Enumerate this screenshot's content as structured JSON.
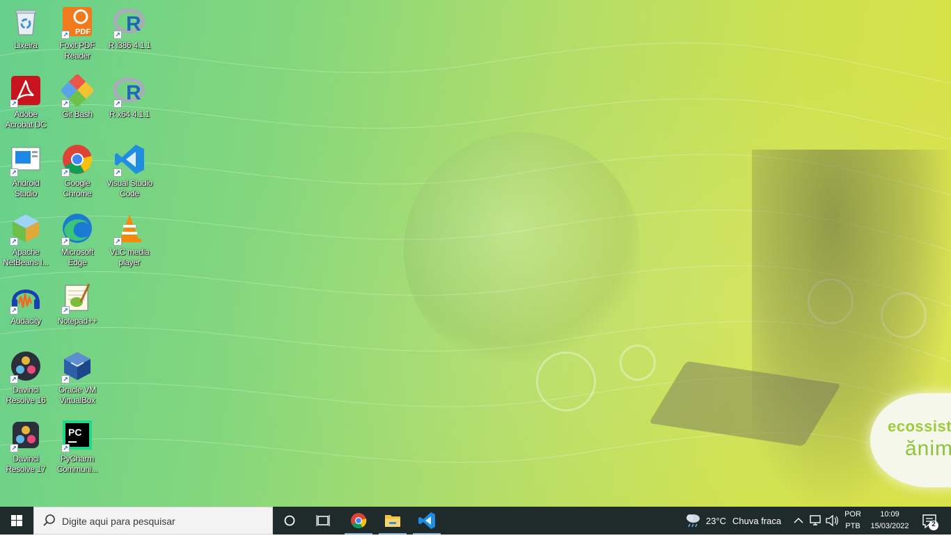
{
  "desktop": {
    "wallpaper": {
      "brand_line1": "ecossist",
      "brand_line2": "ănim"
    },
    "icons": [
      {
        "label": "Lixeira",
        "icon": "recycle-bin-icon",
        "shortcut": false
      },
      {
        "label": "Foxit PDF Reader",
        "icon": "foxit-pdf-icon",
        "badge": "PDF",
        "shortcut": true
      },
      {
        "label": "R i386 4.1.1",
        "icon": "r-logo-icon",
        "glyph": "R",
        "shortcut": true
      },
      {
        "label": "Adobe Acrobat DC",
        "icon": "adobe-acrobat-icon",
        "shortcut": true
      },
      {
        "label": "Git Bash",
        "icon": "git-bash-icon",
        "shortcut": true
      },
      {
        "label": "R x64 4.1.1",
        "icon": "r-logo-icon",
        "glyph": "R",
        "shortcut": true
      },
      {
        "label": "Android Studio",
        "icon": "android-studio-icon",
        "shortcut": true
      },
      {
        "label": "Google Chrome",
        "icon": "chrome-icon",
        "shortcut": true
      },
      {
        "label": "Visual Studio Code",
        "icon": "vscode-icon",
        "shortcut": true
      },
      {
        "label": "Apache NetBeans I...",
        "icon": "netbeans-icon",
        "shortcut": true
      },
      {
        "label": "Microsoft Edge",
        "icon": "edge-icon",
        "shortcut": true
      },
      {
        "label": "VLC media player",
        "icon": "vlc-icon",
        "shortcut": true
      },
      {
        "label": "Audacity",
        "icon": "audacity-icon",
        "shortcut": true
      },
      {
        "label": "Notepad++",
        "icon": "notepadpp-icon",
        "shortcut": true
      },
      {
        "label": "Davinci Resolve 16",
        "icon": "davinci-resolve-icon",
        "shortcut": true
      },
      {
        "label": "Oracle VM VirtualBox",
        "icon": "virtualbox-icon",
        "shortcut": true
      },
      {
        "label": "Davinci Resolve 17",
        "icon": "davinci-resolve-icon",
        "shortcut": true
      },
      {
        "label": "PyCharm Communi...",
        "icon": "pycharm-icon",
        "badge": "PC",
        "shortcut": true
      }
    ]
  },
  "taskbar": {
    "search": {
      "placeholder": "Digite aqui para pesquisar"
    },
    "pinned": [
      {
        "name": "Google Chrome",
        "icon": "chrome-icon",
        "running": true
      },
      {
        "name": "File Explorer",
        "icon": "folder-icon",
        "running": true
      },
      {
        "name": "Visual Studio Code",
        "icon": "vscode-icon",
        "running": true
      }
    ],
    "weather": {
      "temp": "23°C",
      "condition": "Chuva fraca"
    },
    "language": {
      "line1": "POR",
      "line2": "PTB"
    },
    "clock": {
      "time": "10:09",
      "date": "15/03/2022"
    },
    "notifications": {
      "count": "2"
    }
  },
  "colors": {
    "taskbar_bg": "#1f2a2b",
    "wallpaper_left": "#66d08c",
    "wallpaper_right": "#d9e247",
    "vscode_blue": "#1f8ee0",
    "chrome_red": "#db4437",
    "chrome_yellow": "#f4c20d",
    "chrome_green": "#0f9d58",
    "chrome_blue": "#4285f4"
  }
}
